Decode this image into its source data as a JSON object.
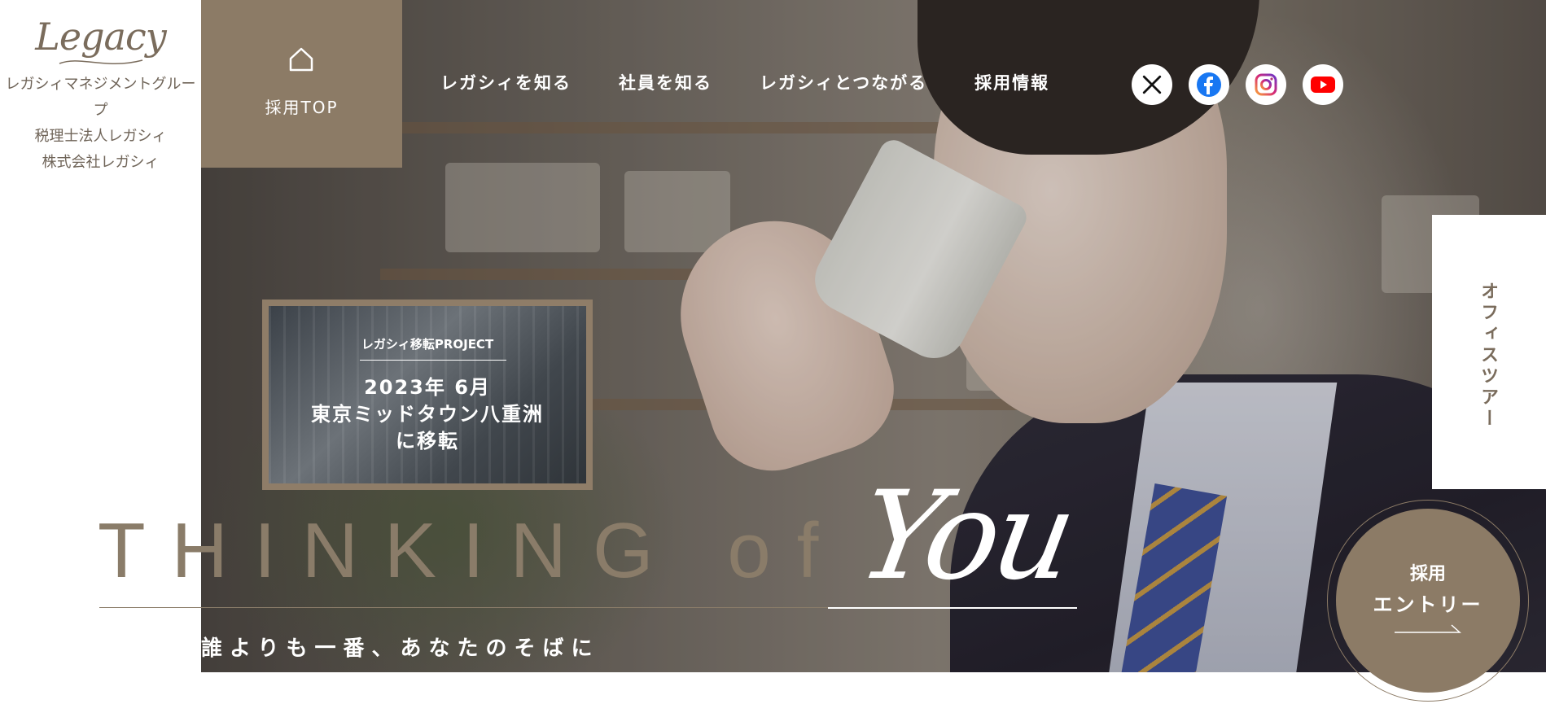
{
  "brand": {
    "logo_text": "Legacy",
    "lines": [
      "レガシィマネジメントグループ",
      "税理士法人レガシィ",
      "株式会社レガシィ"
    ]
  },
  "top_tile": {
    "icon": "home-icon",
    "label": "採用TOP"
  },
  "nav": {
    "items": [
      "レガシィを知る",
      "社員を知る",
      "レガシィとつながる",
      "採用情報"
    ]
  },
  "social": [
    {
      "name": "X",
      "icon": "x-icon",
      "color": "#000000"
    },
    {
      "name": "Facebook",
      "icon": "facebook-icon",
      "color": "#1877F2"
    },
    {
      "name": "Instagram",
      "icon": "instagram-icon",
      "color": "#D62976"
    },
    {
      "name": "YouTube",
      "icon": "youtube-icon",
      "color": "#FF0000"
    }
  ],
  "promo": {
    "label": "レガシィ移転PROJECT",
    "line1": "2023年 6月",
    "line2": "東京ミッドタウン八重洲",
    "line3": "に移転"
  },
  "hero": {
    "headline": "THINKING of",
    "script_word": "You",
    "subtitle": "誰よりも一番、あなたのそばに"
  },
  "office_tour": {
    "label": "オフィスツアー"
  },
  "entry": {
    "line1": "採用",
    "line2": "エントリー"
  },
  "colors": {
    "accent": "#8C7B66",
    "text_brown": "#7A6C5C"
  }
}
